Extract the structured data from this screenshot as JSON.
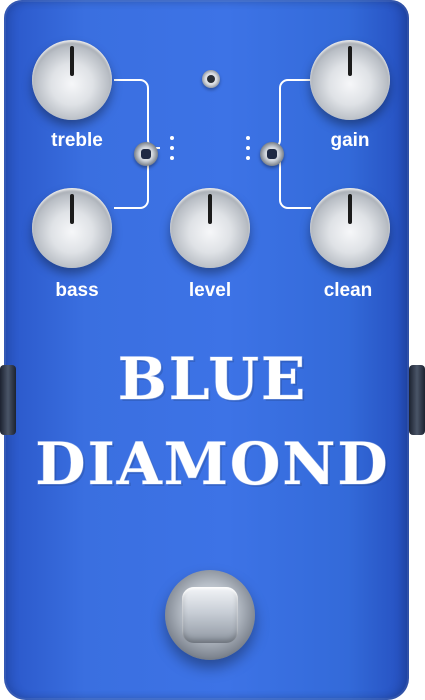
{
  "pedal": {
    "title_line1": "BLUE",
    "title_line2": "DIAMOND",
    "body_color": "#3d73e6",
    "knobs": {
      "treble": "treble",
      "bass": "bass",
      "level": "level",
      "gain": "gain",
      "clean": "clean"
    }
  }
}
